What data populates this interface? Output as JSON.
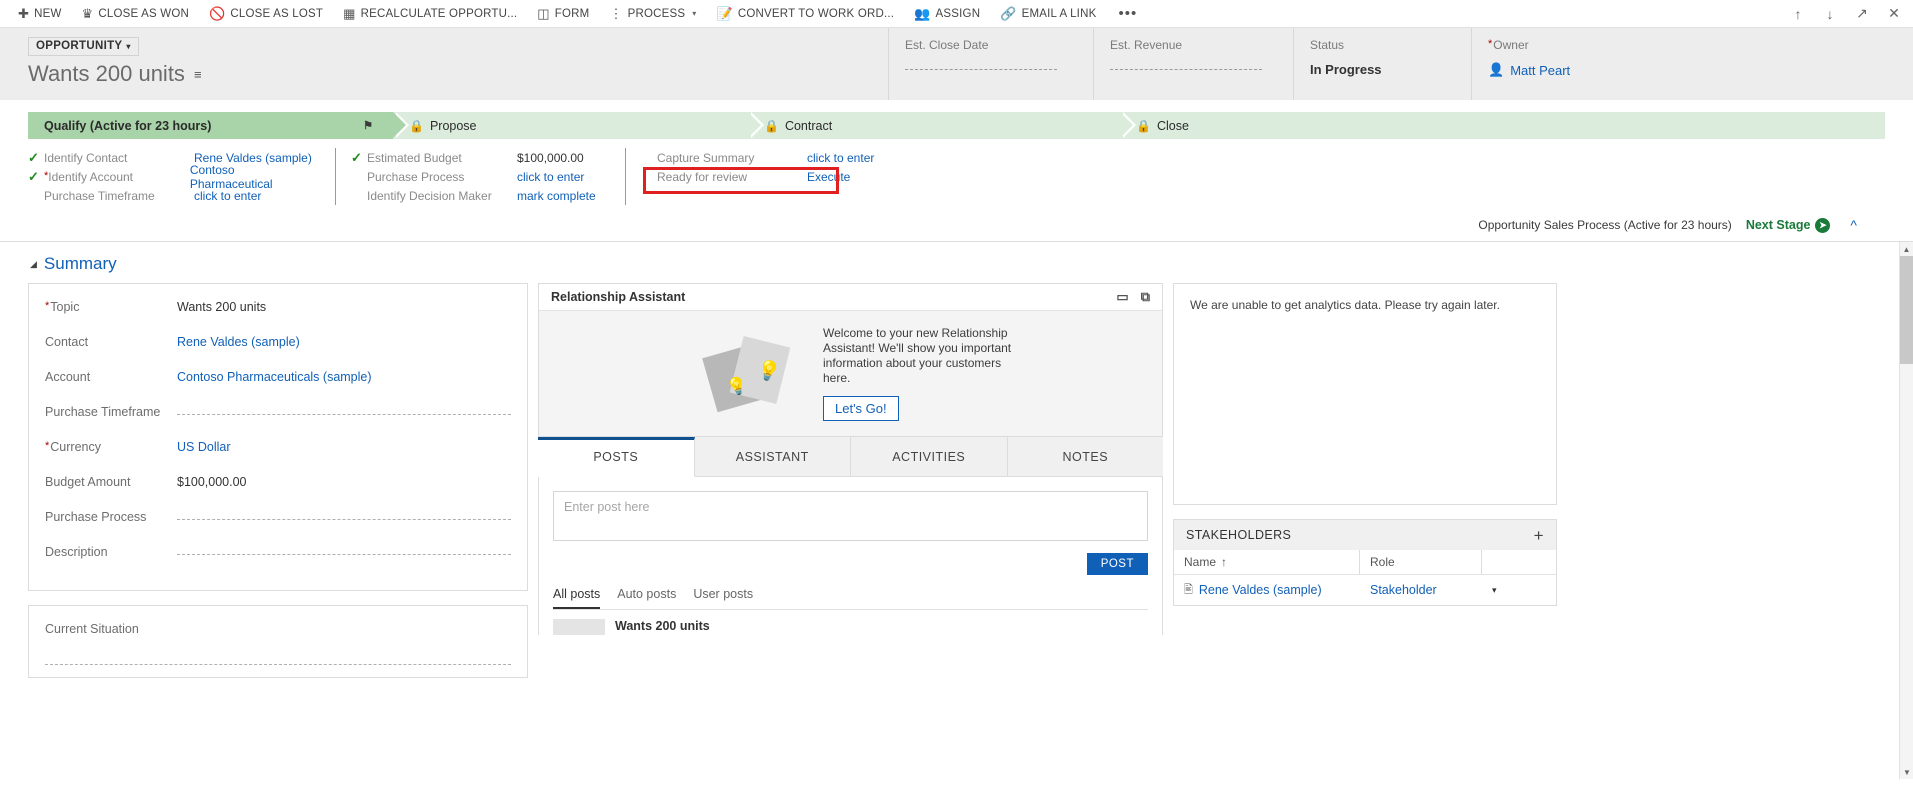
{
  "commandbar": {
    "items": [
      {
        "label": "NEW",
        "icon": "plus-icon"
      },
      {
        "label": "CLOSE AS WON",
        "icon": "trophy-icon"
      },
      {
        "label": "CLOSE AS LOST",
        "icon": "block-icon"
      },
      {
        "label": "RECALCULATE OPPORTU...",
        "icon": "calculator-icon"
      },
      {
        "label": "FORM",
        "icon": "form-icon"
      },
      {
        "label": "PROCESS",
        "icon": "process-icon",
        "caret": "▾"
      },
      {
        "label": "CONVERT TO WORK ORD...",
        "icon": "convert-icon"
      },
      {
        "label": "ASSIGN",
        "icon": "assign-icon"
      },
      {
        "label": "EMAIL A LINK",
        "icon": "link-icon"
      }
    ],
    "overflow": "•••",
    "right_buttons": [
      {
        "name": "up-arrow-icon",
        "glyph": "↑"
      },
      {
        "name": "down-arrow-icon",
        "glyph": "↓"
      },
      {
        "name": "popout-icon",
        "glyph": "↗"
      },
      {
        "name": "close-icon",
        "glyph": "✕"
      }
    ]
  },
  "record_header": {
    "entity_type": "OPPORTUNITY",
    "caret": "▾",
    "title": "Wants 200 units",
    "fields": [
      {
        "label": "Est. Close Date",
        "value": "",
        "empty": true
      },
      {
        "label": "Est. Revenue",
        "value": "",
        "empty": true
      },
      {
        "label": "Status",
        "value": "In Progress",
        "empty": false
      },
      {
        "label": "Owner",
        "value": "Matt Peart",
        "empty": false,
        "required": true,
        "link": true
      }
    ]
  },
  "process_flow": {
    "stages": [
      {
        "name": "Qualify (Active for 23 hours)",
        "state": "active",
        "locked": false
      },
      {
        "name": "Propose",
        "state": "locked",
        "locked": true
      },
      {
        "name": "Contract",
        "state": "locked",
        "locked": true
      },
      {
        "name": "Close",
        "state": "locked",
        "locked": true
      }
    ],
    "columns": [
      {
        "steps": [
          {
            "checked": true,
            "required": false,
            "label": "Identify Contact",
            "value": "Rene Valdes (sample)",
            "link": true
          },
          {
            "checked": true,
            "required": true,
            "label": "Identify Account",
            "value": "Contoso Pharmaceutical",
            "link": true
          },
          {
            "checked": false,
            "required": false,
            "label": "Purchase Timeframe",
            "value": "click to enter",
            "link": true
          }
        ]
      },
      {
        "steps": [
          {
            "checked": true,
            "required": false,
            "label": "Estimated Budget",
            "value": "$100,000.00",
            "link": false
          },
          {
            "checked": false,
            "required": false,
            "label": "Purchase Process",
            "value": "click to enter",
            "link": true
          },
          {
            "checked": false,
            "required": false,
            "label": "Identify Decision Maker",
            "value": "mark complete",
            "link": true
          }
        ]
      },
      {
        "steps": [
          {
            "checked": false,
            "required": false,
            "label": "Capture Summary",
            "value": "click to enter",
            "link": true
          },
          {
            "checked": false,
            "required": false,
            "label": "Ready for review",
            "value": "Execute",
            "link": true
          }
        ]
      }
    ],
    "footer_text": "Opportunity Sales Process (Active for 23 hours)",
    "next_stage_label": "Next Stage",
    "next_stage_arrow": "➜",
    "collapse_caret": "⌃",
    "highlight_color": "#e02020"
  },
  "summary": {
    "section_title": "Summary",
    "section_caret": "◢",
    "fields": [
      {
        "label": "Topic",
        "value": "Wants 200 units",
        "required": true,
        "link": false,
        "empty": false
      },
      {
        "label": "Contact",
        "value": "Rene Valdes (sample)",
        "required": false,
        "link": true,
        "empty": false
      },
      {
        "label": "Account",
        "value": "Contoso Pharmaceuticals (sample)",
        "required": false,
        "link": true,
        "empty": false
      },
      {
        "label": "Purchase Timeframe",
        "value": "",
        "required": false,
        "link": false,
        "empty": true
      },
      {
        "label": "Currency",
        "value": "US Dollar",
        "required": true,
        "link": true,
        "empty": false
      },
      {
        "label": "Budget Amount",
        "value": "$100,000.00",
        "required": false,
        "link": false,
        "empty": false
      },
      {
        "label": "Purchase Process",
        "value": "",
        "required": false,
        "link": false,
        "empty": true
      },
      {
        "label": "Description",
        "value": "",
        "required": false,
        "link": false,
        "empty": true
      }
    ],
    "current_situation_label": "Current Situation"
  },
  "relationship_assistant": {
    "title": "Relationship Assistant",
    "welcome_text": "Welcome to your new Relationship Assistant! We'll show you important information about your customers here.",
    "button_label": "Let's Go!",
    "header_icons": [
      {
        "name": "comment-icon",
        "glyph": "▭"
      },
      {
        "name": "refresh-card-icon",
        "glyph": "⧉"
      }
    ]
  },
  "social_pane": {
    "tabs": [
      {
        "label": "POSTS",
        "selected": true
      },
      {
        "label": "ASSISTANT",
        "selected": false
      },
      {
        "label": "ACTIVITIES",
        "selected": false
      },
      {
        "label": "NOTES",
        "selected": false
      }
    ],
    "post_placeholder": "Enter post here",
    "post_button": "POST",
    "filters": [
      {
        "label": "All posts",
        "selected": true
      },
      {
        "label": "Auto posts",
        "selected": false
      },
      {
        "label": "User posts",
        "selected": false
      }
    ],
    "first_post_title": "Wants 200 units"
  },
  "analytics": {
    "message": "We are unable to get analytics data. Please try again later."
  },
  "stakeholders": {
    "title": "STAKEHOLDERS",
    "add_icon": "+",
    "columns": [
      "Name",
      "Role"
    ],
    "sort_glyph": "↑",
    "rows": [
      {
        "name": "Rene Valdes (sample)",
        "role": "Stakeholder",
        "caret": "▾",
        "icon": "contact-card-icon"
      }
    ]
  },
  "scrollbar": {
    "up": "▲",
    "down": "▼"
  }
}
